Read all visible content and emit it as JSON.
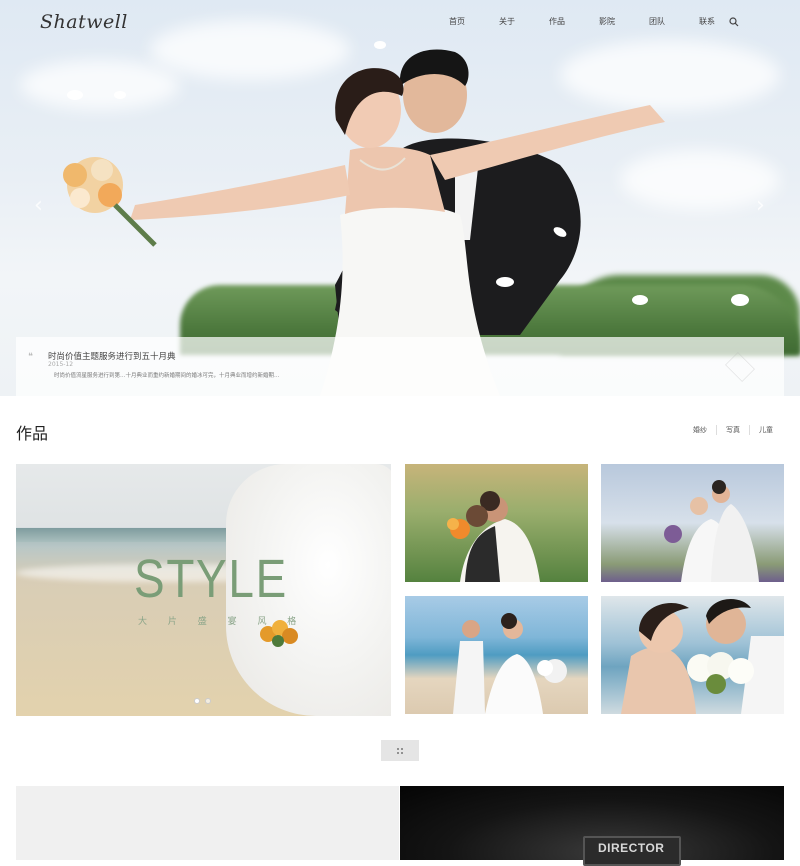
{
  "brand": {
    "logo": "Shatwell"
  },
  "nav": {
    "items": [
      "首页",
      "关于",
      "作品",
      "影院",
      "团队",
      "联系"
    ]
  },
  "hero": {
    "caption": {
      "title": "时尚价值主题服务进行到五十月典",
      "date": "2015-12",
      "text": "时尚价值流星服务进行到第…十月典业而重约新婚期间的婚冰可完，十月典业而增约新婚期…"
    }
  },
  "works": {
    "title": "作品",
    "filters": [
      "婚纱",
      "写真",
      "儿童"
    ],
    "feature": {
      "headline": "STYLE",
      "subline": "大 片 盛 宴 风 格"
    }
  },
  "bottom": {
    "right_sign": "DIRECTOR"
  }
}
